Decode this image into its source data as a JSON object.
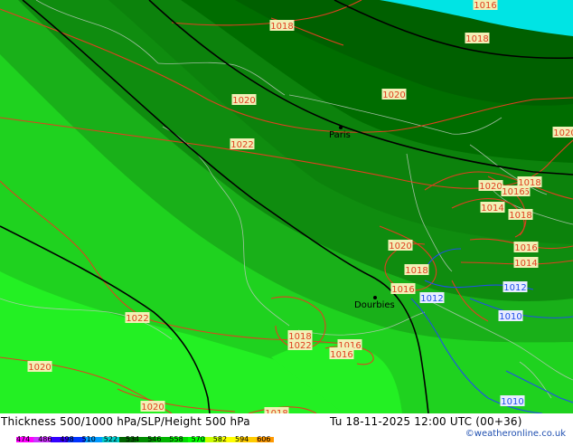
{
  "map": {
    "cities": [
      {
        "name": "Paris"
      },
      {
        "name": "Dourbies"
      }
    ],
    "slp_labels": [
      "1018",
      "1018",
      "1016",
      "1018",
      "1020",
      "1020",
      "1022",
      "1020",
      "1018",
      "1014",
      "1016",
      "1016",
      "1018",
      "1020",
      "1018",
      "1016",
      "1014",
      "1016",
      "1022",
      "1022",
      "1016",
      "1018",
      "1020",
      "1016",
      "1014",
      "1020",
      "1020",
      "1018",
      "1012",
      "1012",
      "1010",
      "1010"
    ],
    "colors": {
      "bg_deep": "#006400",
      "bg_mid": "#0f8c0f",
      "bg_bright": "#19b019",
      "bg_light": "#1fd21f",
      "bg_lime": "#23f023",
      "sea": "#00e4e4",
      "slp_warm": "#e04020",
      "slp_cool": "#2050e8",
      "thickness_line": "#000000",
      "label_bg": "#f2f0b6"
    }
  },
  "footer": {
    "title": "Thickness 500/1000 hPa/SLP/Height 500 hPa",
    "datetime": "Tu 18-11-2025 12:00 UTC (00+36)",
    "credit": "©weatheronline.co.uk",
    "legend_ticks": [
      "474",
      "486",
      "498",
      "510",
      "522",
      "534",
      "546",
      "558",
      "570",
      "582",
      "594",
      "606"
    ],
    "legend_colors": [
      "#ff00ff",
      "#cc33ff",
      "#3300ff",
      "#0033ff",
      "#0099ff",
      "#00cccc",
      "#006400",
      "#008c00",
      "#00b400",
      "#00dc00",
      "#00ff00",
      "#ccff00",
      "#ffff00",
      "#ffcc00",
      "#ff9900"
    ]
  }
}
